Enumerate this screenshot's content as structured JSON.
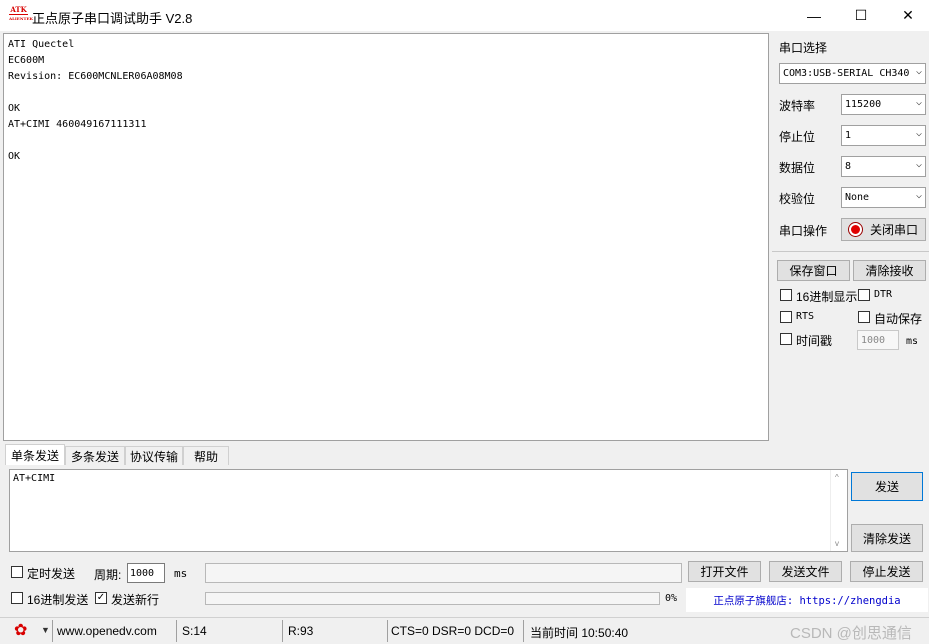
{
  "window": {
    "logo_top": "ATK",
    "logo_bottom": "ALIENTEK",
    "title": "正点原子串口调试助手 V2.8",
    "minimize": "—",
    "maximize": "☐",
    "close": "✕"
  },
  "receive": {
    "text": "ATI Quectel\nEC600M\nRevision: EC600MCNLER06A08M08\n\nOK\nAT+CIMI 460049167111311\n\nOK"
  },
  "panel": {
    "port_select_label": "串口选择",
    "port_value": "COM3:USB-SERIAL CH340",
    "baud_label": "波特率",
    "baud_value": "115200",
    "stop_label": "停止位",
    "stop_value": "1",
    "data_label": "数据位",
    "data_value": "8",
    "parity_label": "校验位",
    "parity_value": "None",
    "port_op_label": "串口操作",
    "close_port_button": "关闭串口",
    "save_window_button": "保存窗口",
    "clear_receive_button": "清除接收",
    "hex_display": "16进制显示",
    "dtr": "DTR",
    "rts": "RTS",
    "auto_save": "自动保存",
    "timestamp": "时间戳",
    "timestamp_value": "1000",
    "timestamp_unit": "ms"
  },
  "tabs": [
    "单条发送",
    "多条发送",
    "协议传输",
    "帮助"
  ],
  "send": {
    "text": "AT+CIMI",
    "send_button": "发送",
    "clear_send_button": "清除发送",
    "timed_send": "定时发送",
    "period_label": "周期:",
    "period_value": "1000",
    "period_unit": "ms",
    "open_file_button": "打开文件",
    "send_file_button": "发送文件",
    "stop_send_button": "停止发送",
    "hex_send": "16进制发送",
    "newline_send": "发送新行",
    "progress_text": "0%",
    "progress": 0,
    "store_link": "正点原子旗舰店: https://zhengdia"
  },
  "status": {
    "website": "www.openedv.com",
    "sent": "S:14",
    "received": "R:93",
    "signals": "CTS=0 DSR=0 DCD=0",
    "current_time": "当前时间 10:50:40",
    "watermark": "CSDN @创思通信"
  },
  "colors": {
    "accent_red": "#d80000",
    "link_blue": "#0000cc"
  }
}
